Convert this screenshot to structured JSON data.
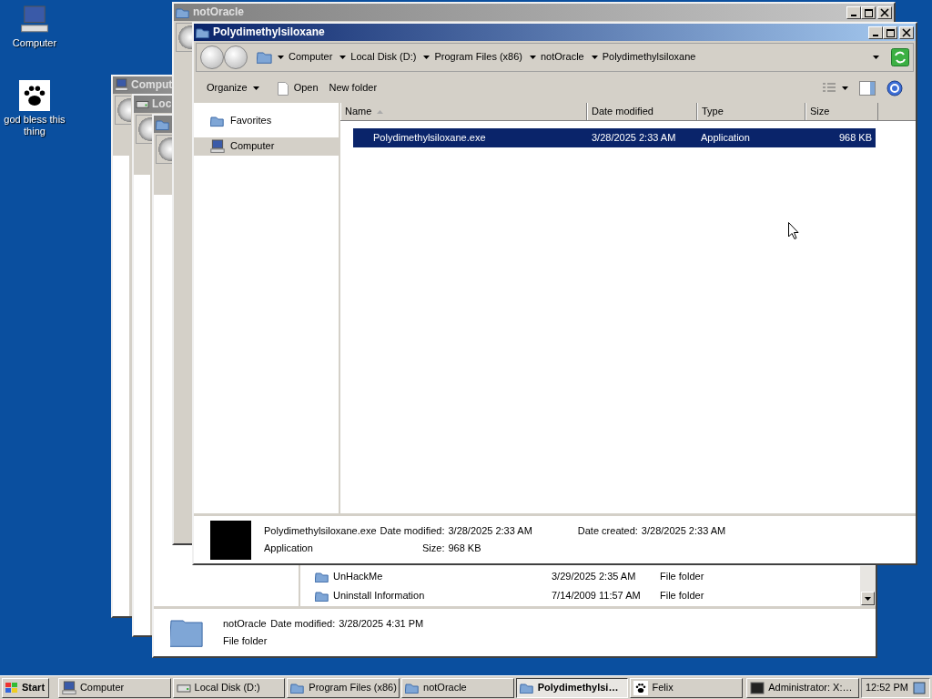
{
  "desktop_icons": [
    {
      "kind": "computer",
      "label": "Computer"
    },
    {
      "kind": "paw",
      "label": "god bless this thing"
    }
  ],
  "background_windows": [
    {
      "kind": "computer",
      "title": "Comput"
    },
    {
      "kind": "disk",
      "title": "Loc"
    }
  ],
  "program_files_window": {
    "rows": [
      {
        "name": "UnHackMe",
        "date": "3/29/2025 2:35 AM",
        "type": "File folder"
      },
      {
        "name": "Uninstall Information",
        "date": "7/14/2009 11:57 AM",
        "type": "File folder"
      }
    ],
    "details": {
      "name": "notOracle",
      "label": "Date modified:",
      "value": "3/28/2025 4:31 PM",
      "type": "File folder"
    }
  },
  "notoracle_window": {
    "title": "notOracle"
  },
  "main_window": {
    "title": "Polydimethylsiloxane",
    "breadcrumb": [
      "Computer",
      "Local Disk (D:)",
      "Program Files (x86)",
      "notOracle",
      "Polydimethylsiloxane"
    ],
    "toolbar": {
      "organize": "Organize",
      "open": "Open",
      "new_folder": "New folder"
    },
    "nav": [
      {
        "kind": "folder",
        "label": "Favorites",
        "selected": false
      },
      {
        "kind": "computer",
        "label": "Computer",
        "selected": true
      }
    ],
    "columns": [
      "Name",
      "Date modified",
      "Type",
      "Size"
    ],
    "files": [
      {
        "name": "Polydimethylsiloxane.exe",
        "date": "3/28/2025 2:33 AM",
        "type": "Application",
        "size": "968 KB",
        "selected": true
      }
    ],
    "details": {
      "name": "Polydimethylsiloxane.exe",
      "type": "Application",
      "modified_label": "Date modified:",
      "modified": "3/28/2025 2:33 AM",
      "created_label": "Date created:",
      "created": "3/28/2025 2:33 AM",
      "size_label": "Size:",
      "size": "968 KB"
    }
  },
  "taskbar": {
    "start": "Start",
    "items": [
      {
        "kind": "computer",
        "label": "Computer",
        "selected": false
      },
      {
        "kind": "disk",
        "label": "Local Disk (D:)",
        "selected": false
      },
      {
        "kind": "folder",
        "label": "Program Files (x86)",
        "selected": false
      },
      {
        "kind": "folder",
        "label": "notOracle",
        "selected": false
      },
      {
        "kind": "folder",
        "label": "Polydimethylsi…",
        "selected": true
      },
      {
        "kind": "paw",
        "label": "Felix",
        "selected": false
      },
      {
        "kind": "console",
        "label": "Administrator: X:…",
        "selected": false
      }
    ],
    "clock": "12:52 PM"
  }
}
